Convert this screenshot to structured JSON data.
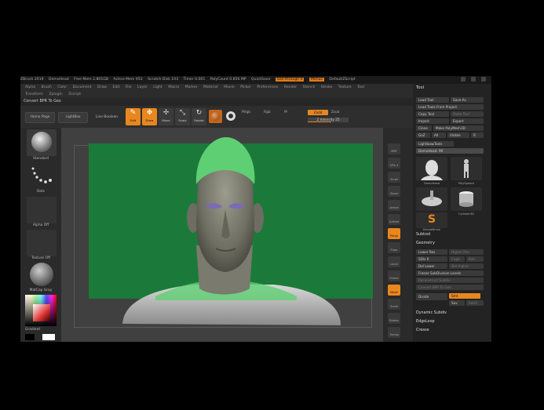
{
  "titlebar": {
    "items": [
      "ZBrush 2019",
      "DemoHead",
      "Free Mem 2.801GB",
      "Active Mem 953",
      "Scratch Disk 103",
      "Timer 0.001",
      "PolyCount 0.856 MP"
    ],
    "quicksave": "QuickSave",
    "seethrough": "See-through 0",
    "menus": "Menus",
    "script": "DefaultZScript"
  },
  "menubar": {
    "row1": [
      "Alpha",
      "Brush",
      "Color",
      "Document",
      "Draw",
      "Edit",
      "File",
      "Layer",
      "Light",
      "Macro",
      "Marker",
      "Material",
      "Movie",
      "Picker",
      "Preferences",
      "Render",
      "Stencil",
      "Stroke",
      "Texture",
      "Tool"
    ],
    "row2": [
      "Transform",
      "Zplugin",
      "Zscript"
    ]
  },
  "convert_label": "Convert BPR To Geo",
  "shelf": {
    "home_page": "Home Page",
    "lightbox": "LightBox",
    "live_boolean": "Live Boolean",
    "tools": [
      {
        "label": "Edit",
        "icon": "edit-icon",
        "glyph": "✎"
      },
      {
        "label": "Draw",
        "icon": "draw-icon",
        "glyph": "✥"
      },
      {
        "label": "Move",
        "icon": "move-icon",
        "glyph": "✢"
      },
      {
        "label": "Scale",
        "icon": "scale-icon",
        "glyph": "⤡"
      },
      {
        "label": "Rotate",
        "icon": "rotate-icon",
        "glyph": "↻"
      }
    ],
    "mrgb": "Mrgb",
    "rgb": "Rgb",
    "m": "M",
    "zadd": "Zadd",
    "zsub": "Zsub",
    "z_intensity": "Z Intensity 25"
  },
  "leftpanel": {
    "standard": "Standard",
    "dots": "Dots",
    "alpha_off": "Alpha Off",
    "texture_off": "Texture Off",
    "matcap": "MatCap Gray",
    "gradient": "Gradient"
  },
  "rightbar": [
    "BPR",
    "SPix 3",
    "Scroll",
    "Zoom",
    "Actual",
    "AAHalf",
    "Persp",
    "Floor",
    "Local",
    "Frame",
    "Move",
    "Scale",
    "Rotate",
    "Transp",
    "Dynamic",
    "Solo"
  ],
  "toolpanel": {
    "title": "Tool",
    "rows": [
      [
        "Load Tool",
        "Save As"
      ],
      [
        "Load Tools From Project",
        ""
      ],
      [
        "Copy Tool",
        "Paste Tool"
      ],
      [
        "Import",
        "Export"
      ],
      [
        "Clone",
        "Make PolyMesh3D"
      ],
      [
        "GoZ",
        "All",
        "Visible",
        "R"
      ]
    ],
    "lightbox_tools": "Lightbox▸Tools",
    "current_tool": "DemoHead. 90",
    "thumbs": [
      "DemoHead",
      "PolySphere",
      "SimpleBrush",
      "Cylinder3D",
      "SimpleBrush"
    ],
    "subtool": "Subtool",
    "geometry": "Geometry",
    "lower_res": "Lower Res",
    "higher_res": "Higher Res",
    "sdiv": "SDiv 6",
    "cage": "Cage",
    "rstr": "Rstr",
    "del_lower": "Del Lower",
    "del_higher": "Del Higher",
    "freeze": "Freeze SubDivision Levels",
    "reconstruct": "Reconstruct Subdiv",
    "convert_bpr": "Convert BPR To Geo",
    "divide": "Divide",
    "smt": "Smt",
    "suv": "Suv",
    "reuv": "ReUV",
    "dynamic_subdiv": "Dynamic Subdiv",
    "edgeloop": "EdgeLoop",
    "crease": "Crease"
  },
  "colors": {
    "accent": "#e8871e",
    "background_green": "#1b7a3a",
    "head_skin": "#8a8a80",
    "cap_green": "#5fcf73"
  }
}
